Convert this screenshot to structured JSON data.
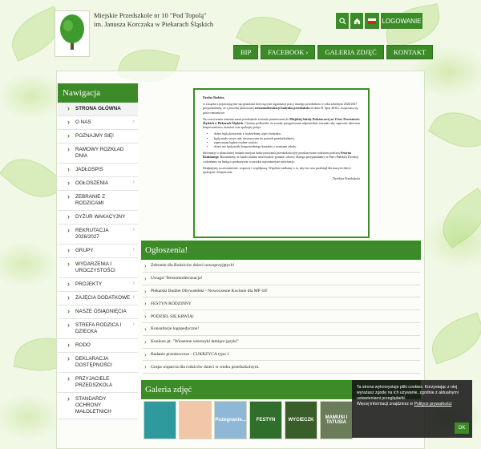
{
  "header": {
    "school_line1": "Miejskie Przedszkole nr 10 \"Pod Topolą\"",
    "school_line2": "im. Janusza Korczaka w Piekarach Śląskich",
    "login_label": "LOGOWANIE",
    "search_icon": "search-icon",
    "home_icon": "home-icon"
  },
  "mainnav": [
    "BIP",
    "FACEBOOK ›",
    "GALERIA ZDJĘĆ",
    "KONTAKT"
  ],
  "sidebar": {
    "title": "Nawigacja",
    "items": [
      {
        "label": "STRONA GŁÓWNA",
        "sub": false
      },
      {
        "label": "O NAS",
        "sub": true
      },
      {
        "label": "POZNAJMY SIĘ!",
        "sub": false
      },
      {
        "label": "RAMOWY ROZKŁAD DNIA",
        "sub": false
      },
      {
        "label": "JADŁOSPIS",
        "sub": false
      },
      {
        "label": "OGŁOSZENIA",
        "sub": true
      },
      {
        "label": "ZEBRANIE Z RODZICAMI",
        "sub": false
      },
      {
        "label": "DYŻUR WAKACYJNY",
        "sub": false
      },
      {
        "label": "REKRUTACJA 2026/2027",
        "sub": true
      },
      {
        "label": "GRUPY",
        "sub": true
      },
      {
        "label": "WYDARZENIA I UROCZYSTOŚCI",
        "sub": false
      },
      {
        "label": "PROJEKTY",
        "sub": true
      },
      {
        "label": "ZAJĘCIA DODATKOWE",
        "sub": true
      },
      {
        "label": "NASZE OSIĄGNIĘCIA",
        "sub": false
      },
      {
        "label": "STREFA RODZICA I DZIECKA",
        "sub": true
      },
      {
        "label": "RODO",
        "sub": false
      },
      {
        "label": "DEKLARACJA DOSTĘPNOŚCI",
        "sub": false
      },
      {
        "label": "PRZYJACIELE PRZEDSZKOLA",
        "sub": false
      },
      {
        "label": "STANDARDY OCHRONY MAŁOLETNICH",
        "sub": false
      }
    ]
  },
  "notice": {
    "greeting": "Drodzy Rodzice,",
    "p1_a": "w związku z pojawiającymi się pytaniami dotyczącymi organizacji pracy naszego przedszkola w roku szkolnym 2026/2027 przypominamy, że z powodu planowanej ",
    "p1_bold": "termomodernizacji budynku przedszkola",
    "p1_b": " od dnia 01 lipca 2026 r. rozpoczną się prace remontowe.",
    "p2_a": "Na czas trwania remontu nasze przedszkole zostanie przeniesione do ",
    "p2_bold": "Miejskiej Szkoły Podstawowej nr 13 im. Powstańców Śląskich w Piekarach Śląskich",
    "p2_b": ". Chcemy podkreślić, że zostały przygotowane odpowiednie warunki, aby zapewnić dzieciom bezpieczeństwo, komfort oraz spokojny pobyt:",
    "bullets": [
      "dzieci będą korzystały z wydzielonej części budynku,",
      "będą miały swoje sale, dostosowane do potrzeb przedszkolaków,",
      "zapewniane będzie osobne wejście,",
      "dzieci nie będą miały bezpośredniego kontaktu z uczniami szkoły."
    ],
    "p3_a": "Informacje o planowanej zmianie miejsca funkcjonowania przedszkola były przekazywane rodzicom podczas ",
    "p3_bold": "Festynu Rodzinnego",
    "p3_b": ". Rozumiemy, że każda zmiana może budzić pytania i obawy, dlatego przypominamy że Pań i Pańskiej Dyrekcji i udzielamy na bieżąco przekazywać wszystkie najważniejsze informacje.",
    "p4": "Dziękujemy za zrozumienie, wsparcie i współpracę. Wspólnie zadbamy o to, aby ten czas przebiegł dla naszych dzieci spokojnie i bezpiecznie.",
    "signature": "Dyrektor Przedszkola"
  },
  "announcements": {
    "title": "Ogłoszenia!",
    "items": [
      "Zebranie dla Rodziców dzieci nowoprzyjętych!",
      "Uwaga! Termomodernizacja!",
      "Piekarski Budżet Obywatelski - Nowoczesne Kuchnie dla MP-10!",
      "FESTYN RODZINNY",
      "PODZIEL SIĘ KRWIĄ!",
      "Konsultacje logopedyczne!",
      "Konkurs pt. \"Wiosenne wierszyki łamiące języki\"",
      "Badanie przesiewowe - CUKRZYCA typu 1",
      "Grupa wsparcia dla rodziców dzieci w wieku przedszkolnym."
    ]
  },
  "gallery": {
    "title": "Galeria zdjęć",
    "thumbs": [
      {
        "label": "",
        "color": "#2f9a9e"
      },
      {
        "label": "",
        "color": "#f2c7a8"
      },
      {
        "label": "Pożegnanie...",
        "color": "#8fb7d6"
      },
      {
        "label": "FESTYN",
        "color": "#2f6e2b"
      },
      {
        "label": "WYCIECZK",
        "color": "#3a5e2a"
      },
      {
        "label": "MAMUSI I TATUSIA",
        "color": "#6b7c5a"
      }
    ]
  },
  "cookie": {
    "text1": "Ta strona wykorzystuje pliki cookies. Korzystając z niej wyrażasz zgodę na ich używanie, zgodnie z aktualnymi ustawieniami przeglądarki.",
    "text2": "Więcej informacji znajdziesz w ",
    "link": "Polityce prywatności",
    "ok": "OK"
  },
  "colors": {
    "accent": "#3c8a28",
    "accent_dark": "#2e6f1e"
  }
}
